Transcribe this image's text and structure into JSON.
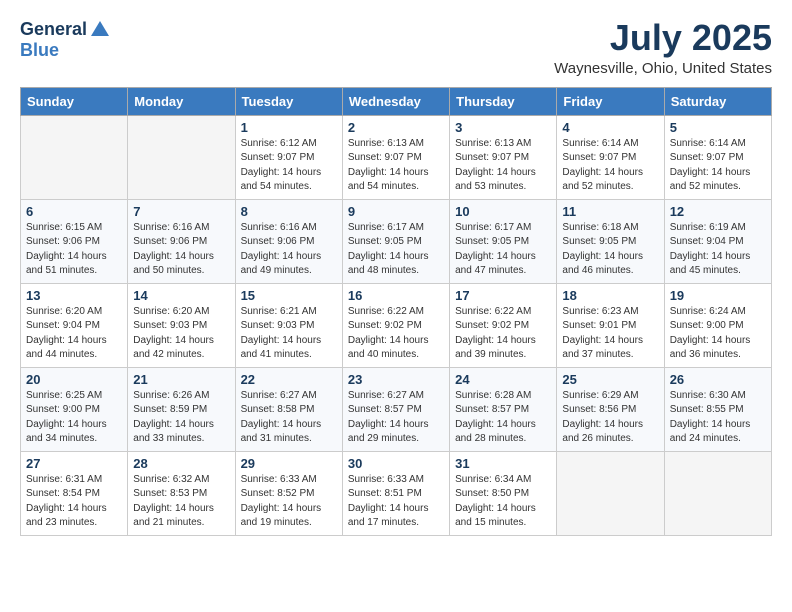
{
  "header": {
    "logo_general": "General",
    "logo_blue": "Blue",
    "main_title": "July 2025",
    "subtitle": "Waynesville, Ohio, United States"
  },
  "calendar": {
    "days": [
      "Sunday",
      "Monday",
      "Tuesday",
      "Wednesday",
      "Thursday",
      "Friday",
      "Saturday"
    ],
    "weeks": [
      [
        {
          "day": "",
          "sunrise": "",
          "sunset": "",
          "daylight": "",
          "empty": true
        },
        {
          "day": "",
          "sunrise": "",
          "sunset": "",
          "daylight": "",
          "empty": true
        },
        {
          "day": "1",
          "sunrise": "Sunrise: 6:12 AM",
          "sunset": "Sunset: 9:07 PM",
          "daylight": "Daylight: 14 hours and 54 minutes.",
          "empty": false
        },
        {
          "day": "2",
          "sunrise": "Sunrise: 6:13 AM",
          "sunset": "Sunset: 9:07 PM",
          "daylight": "Daylight: 14 hours and 54 minutes.",
          "empty": false
        },
        {
          "day": "3",
          "sunrise": "Sunrise: 6:13 AM",
          "sunset": "Sunset: 9:07 PM",
          "daylight": "Daylight: 14 hours and 53 minutes.",
          "empty": false
        },
        {
          "day": "4",
          "sunrise": "Sunrise: 6:14 AM",
          "sunset": "Sunset: 9:07 PM",
          "daylight": "Daylight: 14 hours and 52 minutes.",
          "empty": false
        },
        {
          "day": "5",
          "sunrise": "Sunrise: 6:14 AM",
          "sunset": "Sunset: 9:07 PM",
          "daylight": "Daylight: 14 hours and 52 minutes.",
          "empty": false
        }
      ],
      [
        {
          "day": "6",
          "sunrise": "Sunrise: 6:15 AM",
          "sunset": "Sunset: 9:06 PM",
          "daylight": "Daylight: 14 hours and 51 minutes.",
          "empty": false
        },
        {
          "day": "7",
          "sunrise": "Sunrise: 6:16 AM",
          "sunset": "Sunset: 9:06 PM",
          "daylight": "Daylight: 14 hours and 50 minutes.",
          "empty": false
        },
        {
          "day": "8",
          "sunrise": "Sunrise: 6:16 AM",
          "sunset": "Sunset: 9:06 PM",
          "daylight": "Daylight: 14 hours and 49 minutes.",
          "empty": false
        },
        {
          "day": "9",
          "sunrise": "Sunrise: 6:17 AM",
          "sunset": "Sunset: 9:05 PM",
          "daylight": "Daylight: 14 hours and 48 minutes.",
          "empty": false
        },
        {
          "day": "10",
          "sunrise": "Sunrise: 6:17 AM",
          "sunset": "Sunset: 9:05 PM",
          "daylight": "Daylight: 14 hours and 47 minutes.",
          "empty": false
        },
        {
          "day": "11",
          "sunrise": "Sunrise: 6:18 AM",
          "sunset": "Sunset: 9:05 PM",
          "daylight": "Daylight: 14 hours and 46 minutes.",
          "empty": false
        },
        {
          "day": "12",
          "sunrise": "Sunrise: 6:19 AM",
          "sunset": "Sunset: 9:04 PM",
          "daylight": "Daylight: 14 hours and 45 minutes.",
          "empty": false
        }
      ],
      [
        {
          "day": "13",
          "sunrise": "Sunrise: 6:20 AM",
          "sunset": "Sunset: 9:04 PM",
          "daylight": "Daylight: 14 hours and 44 minutes.",
          "empty": false
        },
        {
          "day": "14",
          "sunrise": "Sunrise: 6:20 AM",
          "sunset": "Sunset: 9:03 PM",
          "daylight": "Daylight: 14 hours and 42 minutes.",
          "empty": false
        },
        {
          "day": "15",
          "sunrise": "Sunrise: 6:21 AM",
          "sunset": "Sunset: 9:03 PM",
          "daylight": "Daylight: 14 hours and 41 minutes.",
          "empty": false
        },
        {
          "day": "16",
          "sunrise": "Sunrise: 6:22 AM",
          "sunset": "Sunset: 9:02 PM",
          "daylight": "Daylight: 14 hours and 40 minutes.",
          "empty": false
        },
        {
          "day": "17",
          "sunrise": "Sunrise: 6:22 AM",
          "sunset": "Sunset: 9:02 PM",
          "daylight": "Daylight: 14 hours and 39 minutes.",
          "empty": false
        },
        {
          "day": "18",
          "sunrise": "Sunrise: 6:23 AM",
          "sunset": "Sunset: 9:01 PM",
          "daylight": "Daylight: 14 hours and 37 minutes.",
          "empty": false
        },
        {
          "day": "19",
          "sunrise": "Sunrise: 6:24 AM",
          "sunset": "Sunset: 9:00 PM",
          "daylight": "Daylight: 14 hours and 36 minutes.",
          "empty": false
        }
      ],
      [
        {
          "day": "20",
          "sunrise": "Sunrise: 6:25 AM",
          "sunset": "Sunset: 9:00 PM",
          "daylight": "Daylight: 14 hours and 34 minutes.",
          "empty": false
        },
        {
          "day": "21",
          "sunrise": "Sunrise: 6:26 AM",
          "sunset": "Sunset: 8:59 PM",
          "daylight": "Daylight: 14 hours and 33 minutes.",
          "empty": false
        },
        {
          "day": "22",
          "sunrise": "Sunrise: 6:27 AM",
          "sunset": "Sunset: 8:58 PM",
          "daylight": "Daylight: 14 hours and 31 minutes.",
          "empty": false
        },
        {
          "day": "23",
          "sunrise": "Sunrise: 6:27 AM",
          "sunset": "Sunset: 8:57 PM",
          "daylight": "Daylight: 14 hours and 29 minutes.",
          "empty": false
        },
        {
          "day": "24",
          "sunrise": "Sunrise: 6:28 AM",
          "sunset": "Sunset: 8:57 PM",
          "daylight": "Daylight: 14 hours and 28 minutes.",
          "empty": false
        },
        {
          "day": "25",
          "sunrise": "Sunrise: 6:29 AM",
          "sunset": "Sunset: 8:56 PM",
          "daylight": "Daylight: 14 hours and 26 minutes.",
          "empty": false
        },
        {
          "day": "26",
          "sunrise": "Sunrise: 6:30 AM",
          "sunset": "Sunset: 8:55 PM",
          "daylight": "Daylight: 14 hours and 24 minutes.",
          "empty": false
        }
      ],
      [
        {
          "day": "27",
          "sunrise": "Sunrise: 6:31 AM",
          "sunset": "Sunset: 8:54 PM",
          "daylight": "Daylight: 14 hours and 23 minutes.",
          "empty": false
        },
        {
          "day": "28",
          "sunrise": "Sunrise: 6:32 AM",
          "sunset": "Sunset: 8:53 PM",
          "daylight": "Daylight: 14 hours and 21 minutes.",
          "empty": false
        },
        {
          "day": "29",
          "sunrise": "Sunrise: 6:33 AM",
          "sunset": "Sunset: 8:52 PM",
          "daylight": "Daylight: 14 hours and 19 minutes.",
          "empty": false
        },
        {
          "day": "30",
          "sunrise": "Sunrise: 6:33 AM",
          "sunset": "Sunset: 8:51 PM",
          "daylight": "Daylight: 14 hours and 17 minutes.",
          "empty": false
        },
        {
          "day": "31",
          "sunrise": "Sunrise: 6:34 AM",
          "sunset": "Sunset: 8:50 PM",
          "daylight": "Daylight: 14 hours and 15 minutes.",
          "empty": false
        },
        {
          "day": "",
          "sunrise": "",
          "sunset": "",
          "daylight": "",
          "empty": true
        },
        {
          "day": "",
          "sunrise": "",
          "sunset": "",
          "daylight": "",
          "empty": true
        }
      ]
    ]
  }
}
